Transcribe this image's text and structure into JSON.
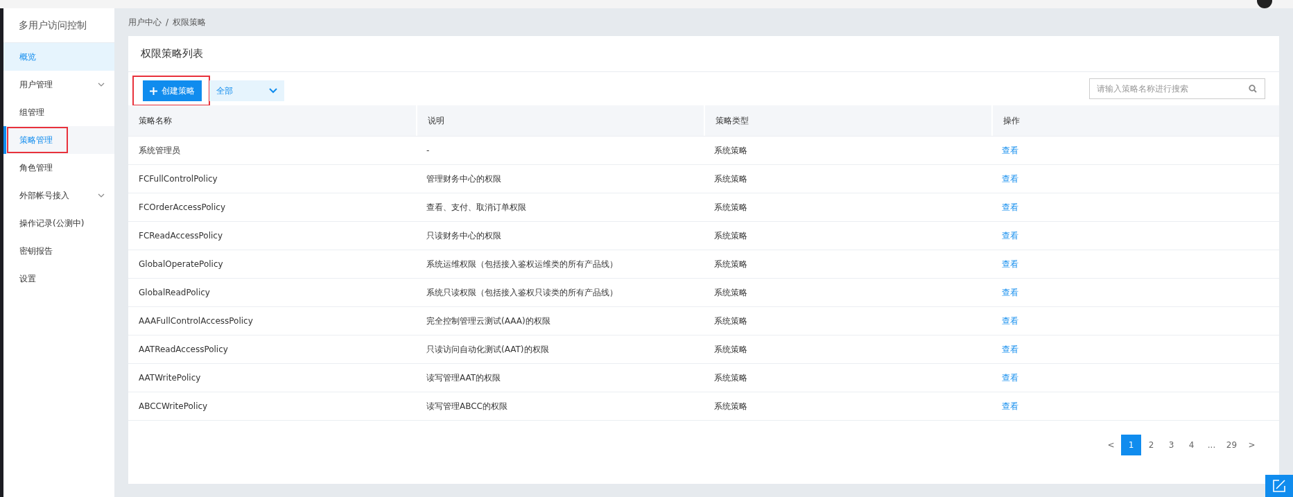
{
  "sidebar": {
    "title": "多用户访问控制",
    "items": [
      {
        "label": "概览",
        "expandable": false,
        "selected": false,
        "hover": true,
        "annotated": false
      },
      {
        "label": "用户管理",
        "expandable": true,
        "selected": false,
        "hover": false,
        "annotated": false
      },
      {
        "label": "组管理",
        "expandable": false,
        "selected": false,
        "hover": false,
        "annotated": false
      },
      {
        "label": "策略管理",
        "expandable": false,
        "selected": true,
        "hover": false,
        "annotated": true
      },
      {
        "label": "角色管理",
        "expandable": false,
        "selected": false,
        "hover": false,
        "annotated": false
      },
      {
        "label": "外部帐号接入",
        "expandable": true,
        "selected": false,
        "hover": false,
        "annotated": false
      },
      {
        "label": "操作记录(公测中)",
        "expandable": false,
        "selected": false,
        "hover": false,
        "annotated": false
      },
      {
        "label": "密钥报告",
        "expandable": false,
        "selected": false,
        "hover": false,
        "annotated": false
      },
      {
        "label": "设置",
        "expandable": false,
        "selected": false,
        "hover": false,
        "annotated": false
      }
    ]
  },
  "breadcrumb": [
    "用户中心",
    "权限策略"
  ],
  "breadcrumb_separator": "/",
  "card": {
    "title": "权限策略列表"
  },
  "toolbar": {
    "create_button": {
      "label": "创建策略",
      "annotated": true
    },
    "filter": {
      "value": "全部"
    },
    "search": {
      "placeholder": "请输入策略名称进行搜索"
    }
  },
  "table": {
    "columns": [
      "策略名称",
      "说明",
      "策略类型",
      "操作"
    ],
    "rows": [
      {
        "name": "系统管理员",
        "description": "-",
        "type": "系统策略",
        "action": "查看"
      },
      {
        "name": "FCFullControlPolicy",
        "description": "管理财务中心的权限",
        "type": "系统策略",
        "action": "查看"
      },
      {
        "name": "FCOrderAccessPolicy",
        "description": "查看、支付、取消订单权限",
        "type": "系统策略",
        "action": "查看"
      },
      {
        "name": "FCReadAccessPolicy",
        "description": "只读财务中心的权限",
        "type": "系统策略",
        "action": "查看"
      },
      {
        "name": "GlobalOperatePolicy",
        "description": "系统运维权限（包括接入鉴权运维类的所有产品线）",
        "type": "系统策略",
        "action": "查看"
      },
      {
        "name": "GlobalReadPolicy",
        "description": "系统只读权限（包括接入鉴权只读类的所有产品线）",
        "type": "系统策略",
        "action": "查看"
      },
      {
        "name": "AAAFullControlAccessPolicy",
        "description": "完全控制管理云测试(AAA)的权限",
        "type": "系统策略",
        "action": "查看"
      },
      {
        "name": "AATReadAccessPolicy",
        "description": "只读访问自动化测试(AAT)的权限",
        "type": "系统策略",
        "action": "查看"
      },
      {
        "name": "AATWritePolicy",
        "description": "读写管理AAT的权限",
        "type": "系统策略",
        "action": "查看"
      },
      {
        "name": "ABCCWritePolicy",
        "description": "读写管理ABCC的权限",
        "type": "系统策略",
        "action": "查看"
      }
    ]
  },
  "pagination": {
    "prev": "<",
    "next": ">",
    "pages": [
      {
        "label": "1",
        "selected": true
      },
      {
        "label": "2",
        "selected": false
      },
      {
        "label": "3",
        "selected": false
      },
      {
        "label": "4",
        "selected": false
      },
      {
        "label": "...",
        "selected": false
      },
      {
        "label": "29",
        "selected": false
      }
    ]
  }
}
